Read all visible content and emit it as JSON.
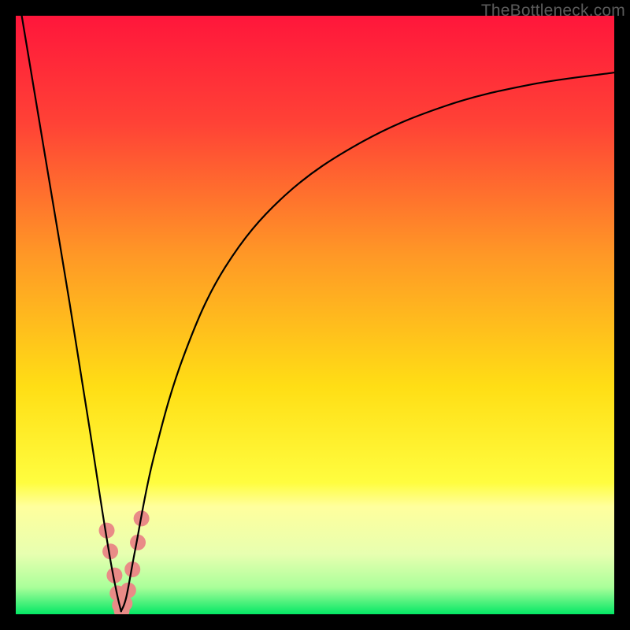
{
  "watermark": {
    "text": "TheBottleneck.com"
  },
  "chart_data": {
    "type": "line",
    "title": "",
    "xlabel": "",
    "ylabel": "",
    "xlim": [
      0,
      100
    ],
    "ylim": [
      0,
      100
    ],
    "grid": false,
    "legend": false,
    "gradient_stops": [
      {
        "pos": 0.0,
        "color": "#ff163b"
      },
      {
        "pos": 0.18,
        "color": "#ff4236"
      },
      {
        "pos": 0.4,
        "color": "#ff9826"
      },
      {
        "pos": 0.62,
        "color": "#ffde15"
      },
      {
        "pos": 0.78,
        "color": "#fffd3f"
      },
      {
        "pos": 0.82,
        "color": "#ffff9d"
      },
      {
        "pos": 0.9,
        "color": "#e7ffb0"
      },
      {
        "pos": 0.955,
        "color": "#aaff9a"
      },
      {
        "pos": 1.0,
        "color": "#04e765"
      }
    ],
    "left_branch": {
      "description": "steep left descent from top-left toward valley",
      "x": [
        1.0,
        5.0,
        9.0,
        12.5,
        14.5,
        16.0,
        17.0,
        17.6
      ],
      "y": [
        100.0,
        76.0,
        52.0,
        30.0,
        17.0,
        8.0,
        3.0,
        0.5
      ]
    },
    "right_branch": {
      "description": "rise out of valley curving to upper-right",
      "x": [
        17.6,
        18.5,
        20.0,
        23.0,
        28.0,
        35.0,
        45.0,
        58.0,
        72.0,
        86.0,
        100.0
      ],
      "y": [
        0.5,
        3.0,
        11.0,
        26.0,
        43.0,
        58.0,
        70.0,
        79.0,
        85.0,
        88.5,
        90.5
      ]
    },
    "markers": {
      "description": "cluster of salmon dots around the valley floor",
      "x": [
        15.2,
        15.8,
        16.5,
        17.0,
        17.4,
        17.7,
        18.2,
        18.8,
        19.5,
        20.4,
        21.0
      ],
      "y": [
        14.0,
        10.5,
        6.5,
        3.5,
        1.5,
        0.6,
        1.8,
        4.0,
        7.5,
        12.0,
        16.0
      ],
      "color": "#e98b87",
      "radius": 10
    },
    "valley_x": 17.6
  }
}
